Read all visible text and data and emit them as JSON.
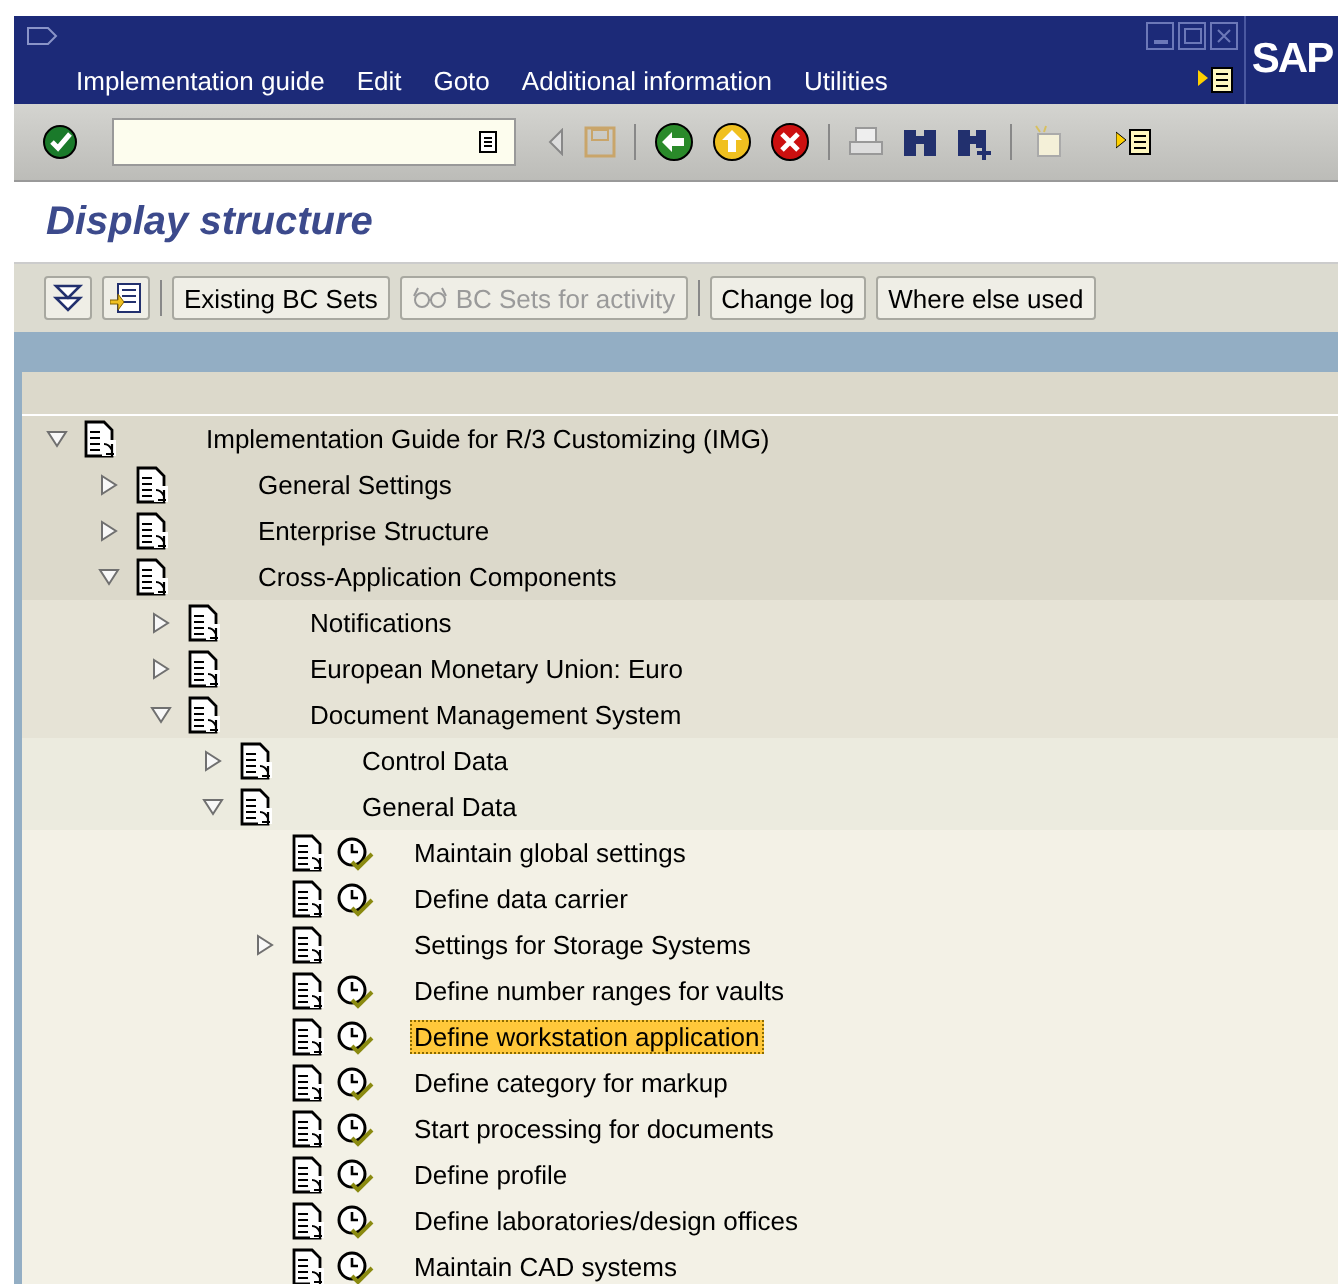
{
  "window": {
    "menu": [
      {
        "label": "Implementation guide"
      },
      {
        "label": "Edit"
      },
      {
        "label": "Goto"
      },
      {
        "label": "Additional information"
      },
      {
        "label": "Utilities"
      }
    ],
    "logo": "SAP"
  },
  "title": "Display structure",
  "app_toolbar": {
    "buttons": [
      {
        "label": "Existing BC Sets",
        "kind": "text",
        "disabled": false
      },
      {
        "label": "BC Sets for activity",
        "kind": "icon-text",
        "disabled": true
      },
      {
        "label": "Change log",
        "kind": "text",
        "disabled": false
      },
      {
        "label": "Where else used",
        "kind": "text",
        "disabled": false
      }
    ]
  },
  "tree": [
    {
      "label": "Implementation Guide for R/3 Customizing (IMG)",
      "kind": "folder",
      "expanded": true,
      "selected": false,
      "children": [
        {
          "label": "General Settings",
          "kind": "folder",
          "expanded": false,
          "selected": false
        },
        {
          "label": "Enterprise Structure",
          "kind": "folder",
          "expanded": false,
          "selected": false
        },
        {
          "label": "Cross-Application Components",
          "kind": "folder",
          "expanded": true,
          "selected": false,
          "children": [
            {
              "label": "Notifications",
              "kind": "folder",
              "expanded": false,
              "selected": false
            },
            {
              "label": "European Monetary Union: Euro",
              "kind": "folder",
              "expanded": false,
              "selected": false
            },
            {
              "label": "Document Management System",
              "kind": "folder",
              "expanded": true,
              "selected": false,
              "children": [
                {
                  "label": "Control Data",
                  "kind": "folder",
                  "expanded": false,
                  "selected": false
                },
                {
                  "label": "General Data",
                  "kind": "folder",
                  "expanded": true,
                  "selected": false,
                  "children": [
                    {
                      "label": "Maintain global settings",
                      "kind": "activity",
                      "selected": false
                    },
                    {
                      "label": "Define data carrier",
                      "kind": "activity",
                      "selected": false
                    },
                    {
                      "label": "Settings for Storage Systems",
                      "kind": "folder",
                      "expanded": false,
                      "selected": false
                    },
                    {
                      "label": "Define number ranges for vaults",
                      "kind": "activity",
                      "selected": false
                    },
                    {
                      "label": "Define workstation application",
                      "kind": "activity",
                      "selected": true
                    },
                    {
                      "label": "Define category for markup",
                      "kind": "activity",
                      "selected": false
                    },
                    {
                      "label": "Start processing for documents",
                      "kind": "activity",
                      "selected": false
                    },
                    {
                      "label": "Define profile",
                      "kind": "activity",
                      "selected": false
                    },
                    {
                      "label": "Define laboratories/design offices",
                      "kind": "activity",
                      "selected": false
                    },
                    {
                      "label": "Maintain CAD systems",
                      "kind": "activity",
                      "selected": false
                    }
                  ]
                }
              ]
            }
          ]
        }
      ]
    }
  ]
}
